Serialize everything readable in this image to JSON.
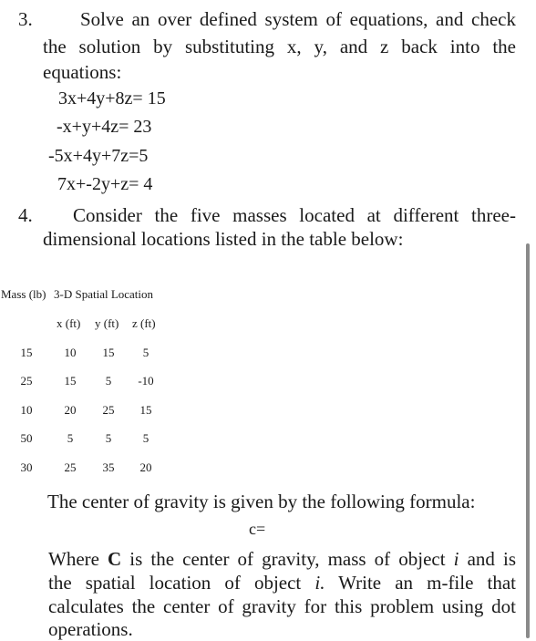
{
  "problem3": {
    "number": "3.",
    "line1": "Solve an over defined system of equations, and check",
    "line2": "the solution by substituting x, y, and z back into the",
    "line3": "equations:",
    "equations": [
      "3x+4y+8z= 15",
      "-x+y+4z= 23",
      "-5x+4y+7z=5",
      "7x+-2y+z= 4"
    ]
  },
  "problem4": {
    "number": "4.",
    "line1": "Consider the five masses located at different three-",
    "line2": "dimensional locations listed in the table below:"
  },
  "table": {
    "header_mass": "Mass (lb)",
    "header_location": "3-D Spatial Location",
    "columns": [
      "x (ft)",
      "y (ft)",
      "z (ft)"
    ],
    "rows": [
      {
        "mass": "15",
        "x": "10",
        "y": "15",
        "z": "5"
      },
      {
        "mass": "25",
        "x": "15",
        "y": "5",
        "z": "-10"
      },
      {
        "mass": "10",
        "x": "20",
        "y": "25",
        "z": "15"
      },
      {
        "mass": "50",
        "x": "5",
        "y": "5",
        "z": "5"
      },
      {
        "mass": "30",
        "x": "25",
        "y": "35",
        "z": "20"
      }
    ]
  },
  "formula": {
    "intro": "The center of gravity is given by the following formula:",
    "expression": "c="
  },
  "explanation": {
    "l1_a": "Where ",
    "l1_bold": "C",
    "l1_b": " is the center of gravity, mass of object ",
    "l1_i": "i",
    "l1_c": " and is",
    "l2_a": "the spatial location of object ",
    "l2_i": "i.",
    "l2_b": " Write an m-file that",
    "l3": "calculates the center of gravity for this problem using dot",
    "l4": "operations."
  }
}
